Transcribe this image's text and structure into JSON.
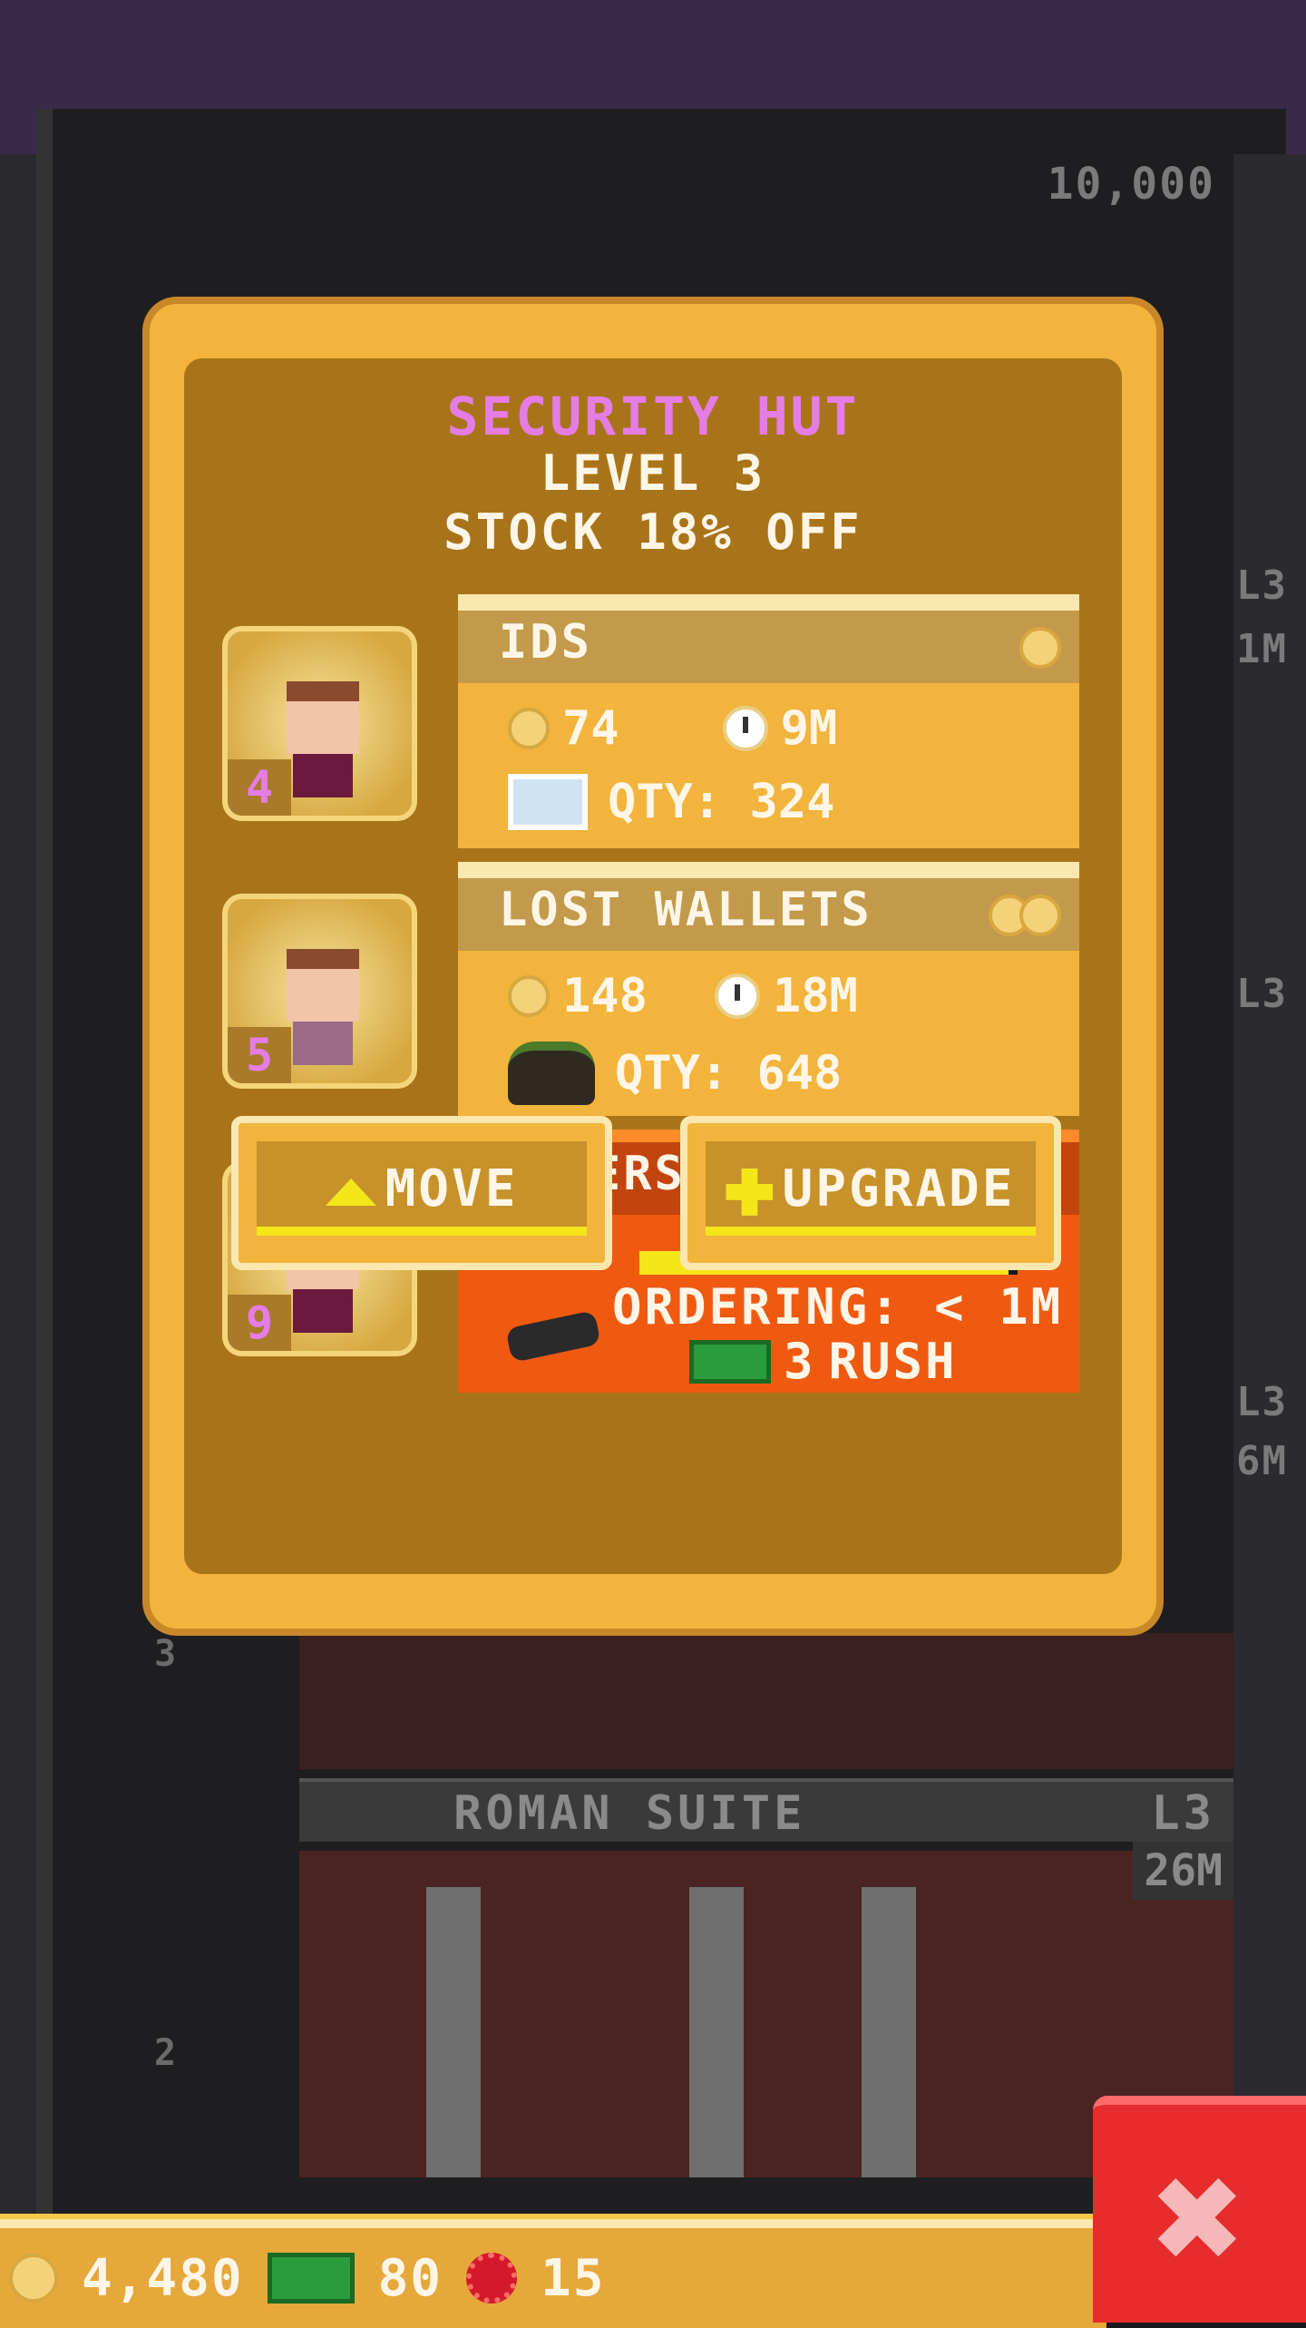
{
  "background": {
    "top_price": "10,000",
    "floor_labels": [
      "L3",
      "1M",
      "L3",
      "L3",
      "6M"
    ],
    "floor_num_upper": "3",
    "floor_num_lower": "2",
    "roman_suite": {
      "name": "ROMAN SUITE",
      "level": "L3",
      "price": "26M"
    }
  },
  "dialog": {
    "title": "SECURITY HUT",
    "level": "LEVEL 3",
    "discount": "STOCK 18% OFF"
  },
  "workers": [
    {
      "level": "4"
    },
    {
      "level": "5"
    },
    {
      "level": "9"
    }
  ],
  "stock": [
    {
      "name": "IDS",
      "cost": "74",
      "time": "9M",
      "qty": "QTY: 324",
      "icon": "id-card-icon"
    },
    {
      "name": "LOST WALLETS",
      "cost": "148",
      "time": "18M",
      "qty": "QTY: 648",
      "icon": "wallet-bag-icon"
    },
    {
      "name": "TASERS",
      "ordering": "ORDERING: < 1M",
      "rush_amount": "3",
      "rush_label": "RUSH",
      "progress_fraction": 0.97,
      "icon": "taser-icon"
    }
  ],
  "buttons": {
    "move": "MOVE",
    "upgrade": "UPGRADE"
  },
  "status_bar": {
    "coins": "4,480",
    "bux": "80",
    "gems": "15"
  },
  "colors": {
    "title_pink": "#e57de6",
    "gold": "#f2b43c",
    "orange_active": "#f05a10",
    "close_red": "#e62c2c"
  }
}
